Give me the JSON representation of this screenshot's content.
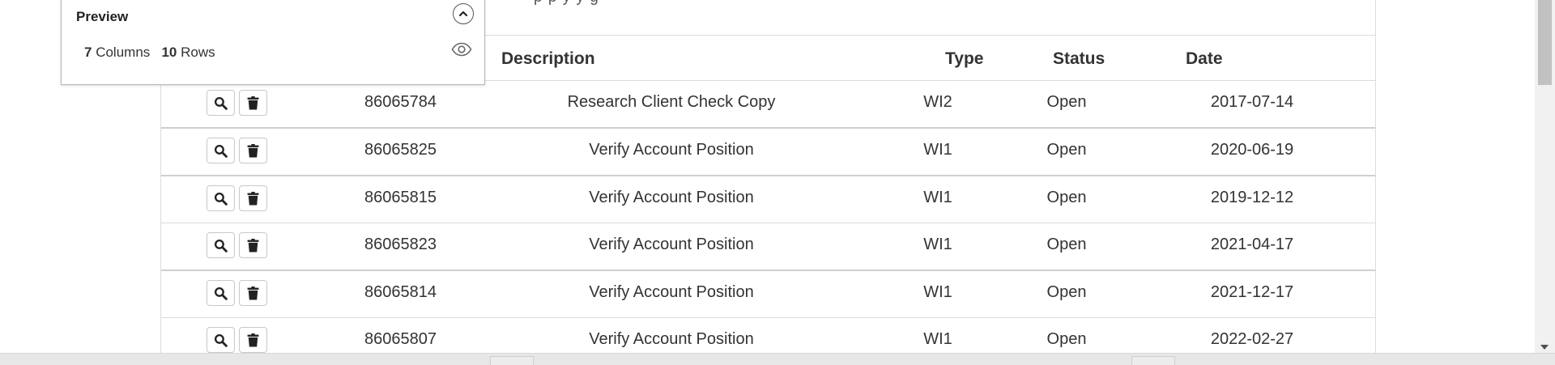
{
  "header_cutoff_text": "p                      p      y y        g",
  "preview": {
    "title": "Preview",
    "columns_count": "7",
    "columns_label": "Columns",
    "rows_count": "10",
    "rows_label": "Rows",
    "collapse_icon": "chevron-up-icon",
    "visibility_icon": "eye-icon"
  },
  "table": {
    "headers": {
      "description": "Description",
      "type": "Type",
      "status": "Status",
      "date": "Date"
    },
    "rows": [
      {
        "id": "86065784",
        "description": "Research Client Check Copy",
        "type": "WI2",
        "status": "Open",
        "date": "2017-07-14"
      },
      {
        "id": "86065825",
        "description": "Verify Account Position",
        "type": "WI1",
        "status": "Open",
        "date": "2020-06-19"
      },
      {
        "id": "86065815",
        "description": "Verify Account Position",
        "type": "WI1",
        "status": "Open",
        "date": "2019-12-12"
      },
      {
        "id": "86065823",
        "description": "Verify Account Position",
        "type": "WI1",
        "status": "Open",
        "date": "2021-04-17"
      },
      {
        "id": "86065814",
        "description": "Verify Account Position",
        "type": "WI1",
        "status": "Open",
        "date": "2021-12-17"
      },
      {
        "id": "86065807",
        "description": "Verify Account Position",
        "type": "WI1",
        "status": "Open",
        "date": "2022-02-27"
      }
    ],
    "row_actions": {
      "view_icon": "search-icon",
      "delete_icon": "trash-icon"
    }
  }
}
